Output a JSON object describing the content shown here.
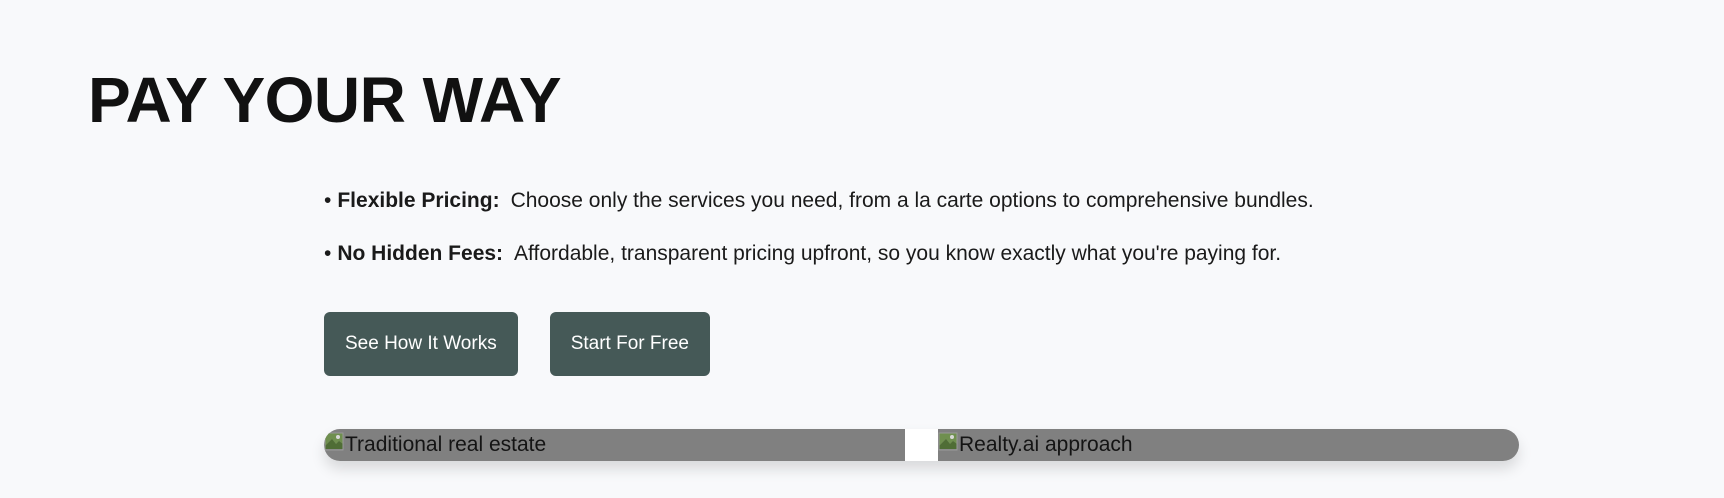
{
  "hero": {
    "title": "PAY YOUR WAY"
  },
  "features": [
    {
      "bullet": "•",
      "title": "Flexible Pricing:",
      "text": "Choose only the services you need, from a la carte options to comprehensive bundles."
    },
    {
      "bullet": "•",
      "title": "No Hidden Fees:",
      "text": "Affordable, transparent pricing upfront, so you know exactly what you're paying for."
    }
  ],
  "buttons": {
    "primary_label": "See How It Works",
    "secondary_label": "Start For Free"
  },
  "comparison": {
    "left_alt": "Traditional real estate",
    "right_alt": "Realty.ai approach"
  },
  "colors": {
    "background": "#f8f9fb",
    "button": "#455957",
    "image_placeholder": "#808080"
  },
  "icons": {
    "broken_image": "broken-image-icon"
  }
}
